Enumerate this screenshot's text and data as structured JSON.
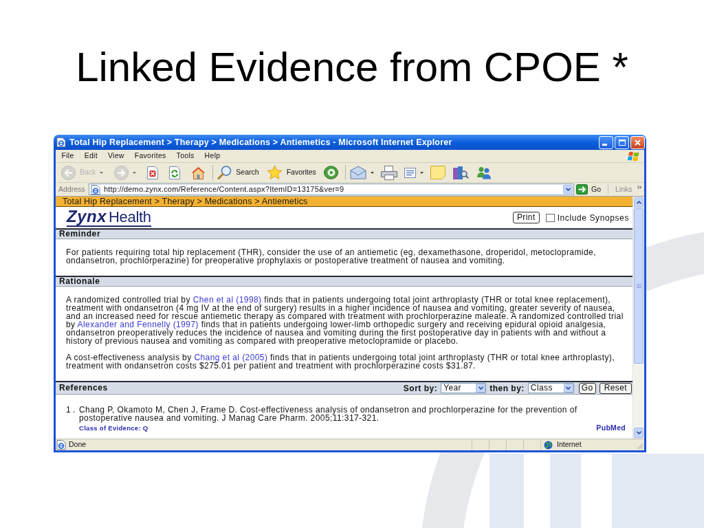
{
  "slide": {
    "title": "Linked Evidence from CPOE *"
  },
  "window": {
    "title": "Total Hip Replacement > Therapy > Medications > Antiemetics - Microsoft Internet Explorer"
  },
  "menu": [
    "File",
    "Edit",
    "View",
    "Favorites",
    "Tools",
    "Help"
  ],
  "toolbar": [
    [
      {
        "kind": "back",
        "label": "Back",
        "disabled": true,
        "dropdown": true
      },
      {
        "kind": "forward",
        "disabled": true,
        "dropdown": true
      },
      {
        "kind": "stop",
        "disabled": false,
        "dropdown": false
      },
      {
        "kind": "refresh",
        "disabled": false,
        "dropdown": false
      },
      {
        "kind": "home",
        "disabled": false,
        "dropdown": false
      }
    ],
    [
      {
        "kind": "search",
        "label": "Search",
        "disabled": false,
        "dropdown": false
      },
      {
        "kind": "favorites",
        "label": "Favorites",
        "disabled": false,
        "dropdown": false
      },
      {
        "kind": "media",
        "disabled": false,
        "dropdown": false
      }
    ],
    [
      {
        "kind": "mail",
        "disabled": false,
        "dropdown": true
      },
      {
        "kind": "print",
        "disabled": false,
        "dropdown": false
      },
      {
        "kind": "edit",
        "disabled": false,
        "dropdown": true
      },
      {
        "kind": "notes",
        "disabled": false,
        "dropdown": false
      },
      {
        "kind": "research",
        "disabled": false,
        "dropdown": false
      },
      {
        "kind": "messenger",
        "disabled": false,
        "dropdown": false
      }
    ]
  ],
  "address_bar": {
    "label": "Address",
    "url": "http://demo.zynx.com/Reference/Content.aspx?ItemID=13175&ver=9",
    "go": "Go",
    "links": "Links"
  },
  "page": {
    "breadcrumb": "Total Hip Replacement > Therapy > Medications > Antiemetics",
    "logo": {
      "brand": "Zynx",
      "product": "Health"
    },
    "print": "Print",
    "include_synopses": {
      "label": "Include Synopses",
      "checked": false
    },
    "sections": [
      {
        "kind": "text",
        "title": "Reminder",
        "paragraphs": [
          [
            {
              "kind": "text",
              "text": "For patients requiring total hip replacement (THR), consider the use of an antiemetic (eg, dexamethasone, droperidol, metoclopramide, ondansetron, prochlorperazine) for preoperative prophylaxis or postoperative treatment of nausea and vomiting."
            }
          ]
        ]
      },
      {
        "kind": "text",
        "title": "Rationale",
        "paragraphs": [
          [
            {
              "kind": "text",
              "text": "A randomized controlled trial by "
            },
            {
              "kind": "link",
              "text": "Chen et al (1998)"
            },
            {
              "kind": "text",
              "text": " finds that in patients undergoing total joint arthroplasty (THR or total knee replacement), treatment with ondansetron (4 mg IV at the end of surgery) results in a higher incidence of nausea and vomiting, greater severity of nausea, and an increased need for rescue antiemetic therapy as compared with treatment with prochlorperazine maleate. A randomized controlled trial by "
            },
            {
              "kind": "link",
              "text": "Alexander and Fennelly (1997)"
            },
            {
              "kind": "text",
              "text": " finds that in patients undergoing lower-limb orthopedic surgery and receiving epidural opioid analgesia, ondansetron preoperatively reduces the incidence of nausea and vomiting during the first postoperative day in patients with and without a history of previous nausea and vomiting as compared with preoperative metoclopramide or placebo."
            }
          ],
          [
            {
              "kind": "text",
              "text": "A cost-effectiveness analysis by "
            },
            {
              "kind": "link",
              "text": "Chang et al (2005)"
            },
            {
              "kind": "text",
              "text": " finds that in patients undergoing total joint arthroplasty (THR or total knee arthroplasty), treatment with ondansetron costs $275.01 per patient and treatment with prochlorperazine costs $31.87."
            }
          ]
        ]
      },
      {
        "kind": "references",
        "title": "References",
        "sort": [
          {
            "label": "Sort by:",
            "value": "Year"
          },
          {
            "label": "then by:",
            "value": "Class"
          }
        ],
        "buttons": [
          "Go",
          "Reset"
        ],
        "items": [
          {
            "number": "1 .",
            "citation": "Chang P, Okamoto M, Chen J, Frame D. Cost-effectiveness analysis of ondansetron and prochlorperazine for the prevention of postoperative nausea and vomiting. J Manag Care Pharm. 2005;11:317-321.",
            "evidence": "Class of Evidence: Q",
            "link": "PubMed"
          }
        ]
      }
    ]
  },
  "status_bar": {
    "text": "Done",
    "zone": "Internet"
  }
}
